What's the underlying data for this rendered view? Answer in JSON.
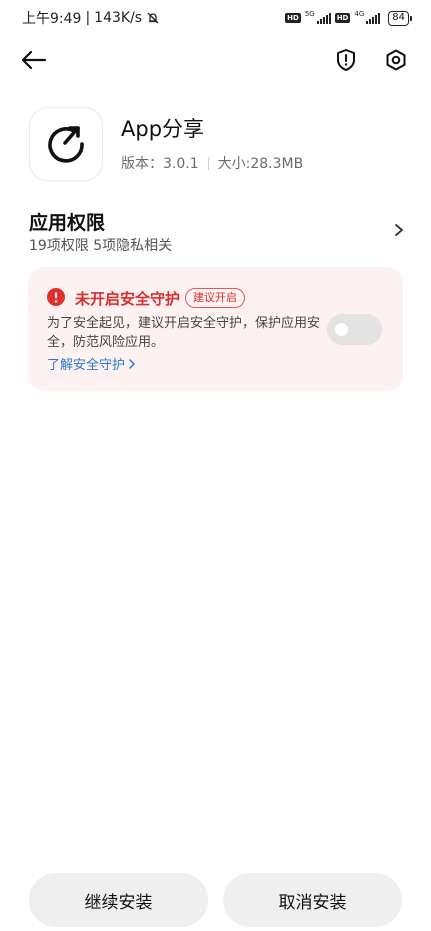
{
  "status_bar": {
    "time": "上午9:49",
    "speed": "143K/s",
    "hd1": "HD",
    "net1": "5G",
    "hd2": "HD",
    "net2": "4G",
    "battery": "84"
  },
  "app": {
    "name": "App分享",
    "version": "版本：3.0.1",
    "size": "大小:28.3MB"
  },
  "permissions": {
    "title": "应用权限",
    "subtitle": "19项权限 5项隐私相关"
  },
  "security": {
    "title": "未开启安全守护",
    "badge": "建议开启",
    "description": "为了安全起见，建议开启安全守护，保护应用安全，防范风险应用。",
    "link": "了解安全守护",
    "toggle_enabled": false
  },
  "buttons": {
    "continue": "继续安装",
    "cancel": "取消安装"
  },
  "colors": {
    "warning": "#d8302e",
    "link": "#2c79c9",
    "card_bg": "#fdf2f1"
  }
}
